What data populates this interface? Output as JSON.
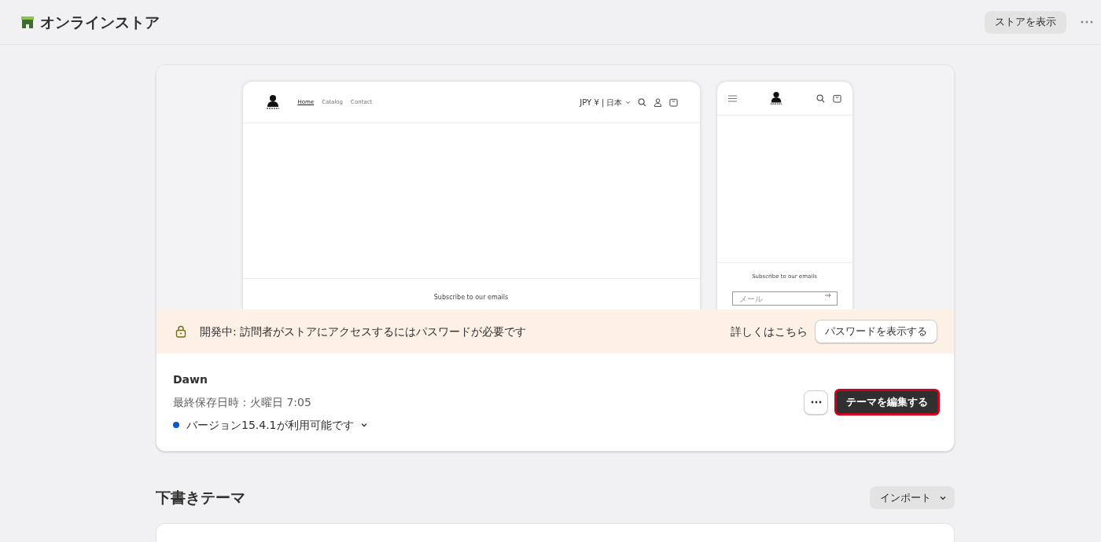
{
  "header": {
    "title": "オンラインストア",
    "view_store_button": "ストアを表示"
  },
  "live_theme": {
    "desktop_preview": {
      "nav": [
        {
          "label": "Home",
          "selected": true
        },
        {
          "label": "Catalog",
          "selected": false
        },
        {
          "label": "Contact",
          "selected": false
        }
      ],
      "currency": "JPY ¥ | 日本",
      "footer_heading": "Subscribe to our emails"
    },
    "mobile_preview": {
      "footer_heading": "Subscribe to our emails",
      "email_placeholder": "メール"
    },
    "banner": {
      "message": "開発中: 訪問者がストアにアクセスするにはパスワードが必要です",
      "link": "詳しくはこちら",
      "button": "パスワードを表示する"
    },
    "name": "Dawn",
    "saved": "最終保存日時：火曜日 7:05",
    "version": {
      "text": "バージョン15.4.1が利用可能です",
      "color": "#0b57d0"
    },
    "edit_button": "テーマを編集する"
  },
  "drafts": {
    "title": "下書きテーマ",
    "import_button": "インポート"
  }
}
